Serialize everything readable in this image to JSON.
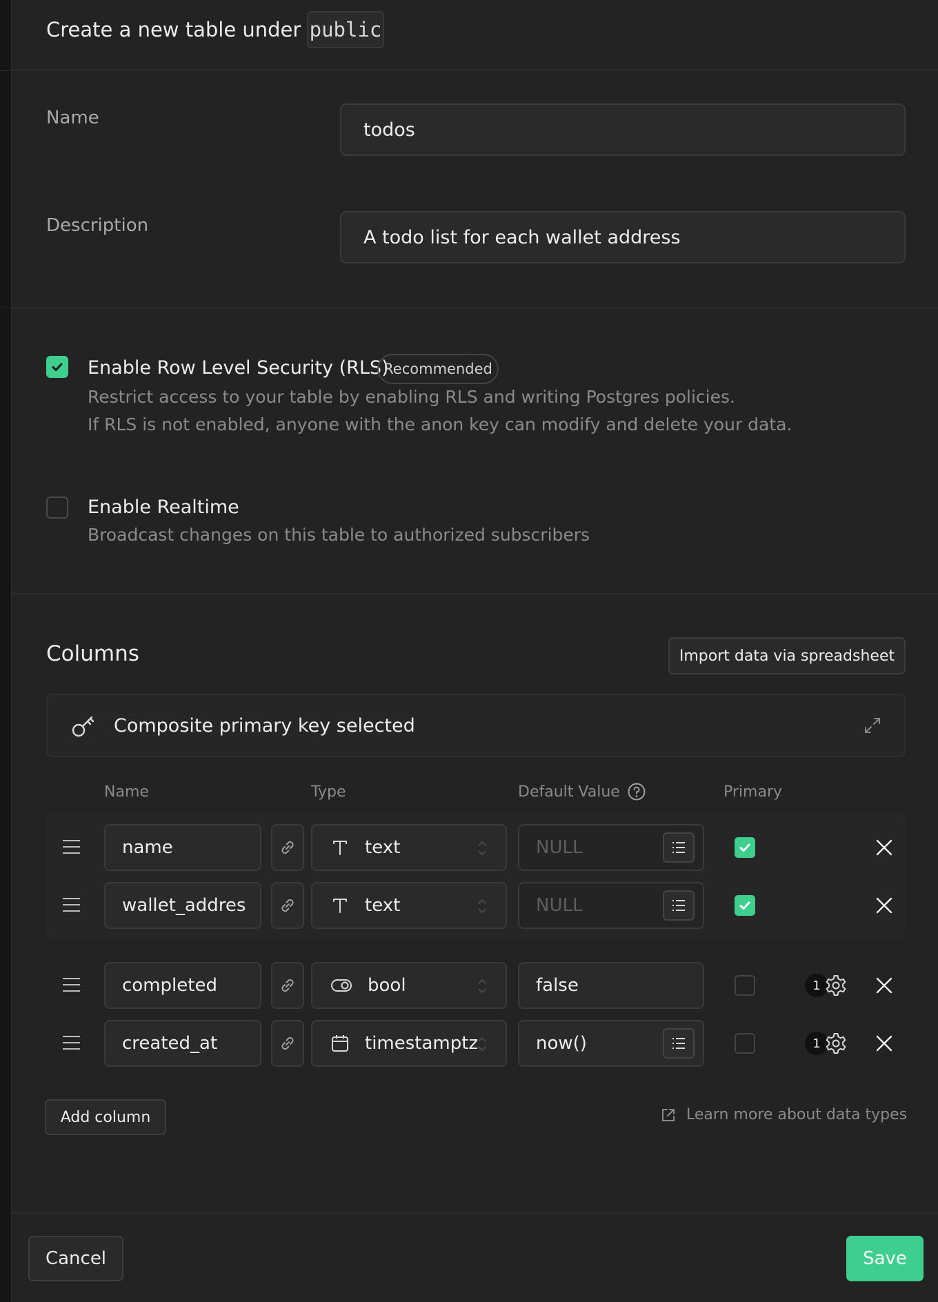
{
  "header": {
    "title": "Create a new table under",
    "schema": "public"
  },
  "form": {
    "name_label": "Name",
    "name_value": "todos",
    "description_label": "Description",
    "description_value": "A todo list for each wallet address"
  },
  "rls": {
    "checked": true,
    "title": "Enable Row Level Security (RLS)",
    "badge": "Recommended",
    "desc1": "Restrict access to your table by enabling RLS and writing Postgres policies.",
    "desc2": "If RLS is not enabled, anyone with the anon key can modify and delete your data."
  },
  "realtime": {
    "checked": false,
    "title": "Enable Realtime",
    "desc": "Broadcast changes on this table to authorized subscribers"
  },
  "columns_section": {
    "title": "Columns",
    "import_button": "Import data via spreadsheet",
    "composite_pk": "Composite primary key selected",
    "headers": {
      "name": "Name",
      "type": "Type",
      "default": "Default Value",
      "primary": "Primary"
    },
    "rows": [
      {
        "name": "name",
        "type": "text",
        "type_icon": "text-type-icon",
        "default": "NULL",
        "primary": true
      },
      {
        "name": "wallet_addres",
        "type": "text",
        "type_icon": "text-type-icon",
        "default": "NULL",
        "primary": true
      },
      {
        "name": "completed",
        "type": "bool",
        "type_icon": "toggle-type-icon",
        "default": "false",
        "primary": false,
        "count": "1"
      },
      {
        "name": "created_at",
        "type": "timestamptz",
        "type_icon": "calendar-type-icon",
        "default": "now()",
        "primary": false,
        "count": "1"
      }
    ],
    "add_column": "Add column",
    "learn_more": "Learn more about data types"
  },
  "footer": {
    "cancel": "Cancel",
    "save": "Save"
  },
  "colors": {
    "accent": "#3ecf8e",
    "background": "#232323"
  }
}
